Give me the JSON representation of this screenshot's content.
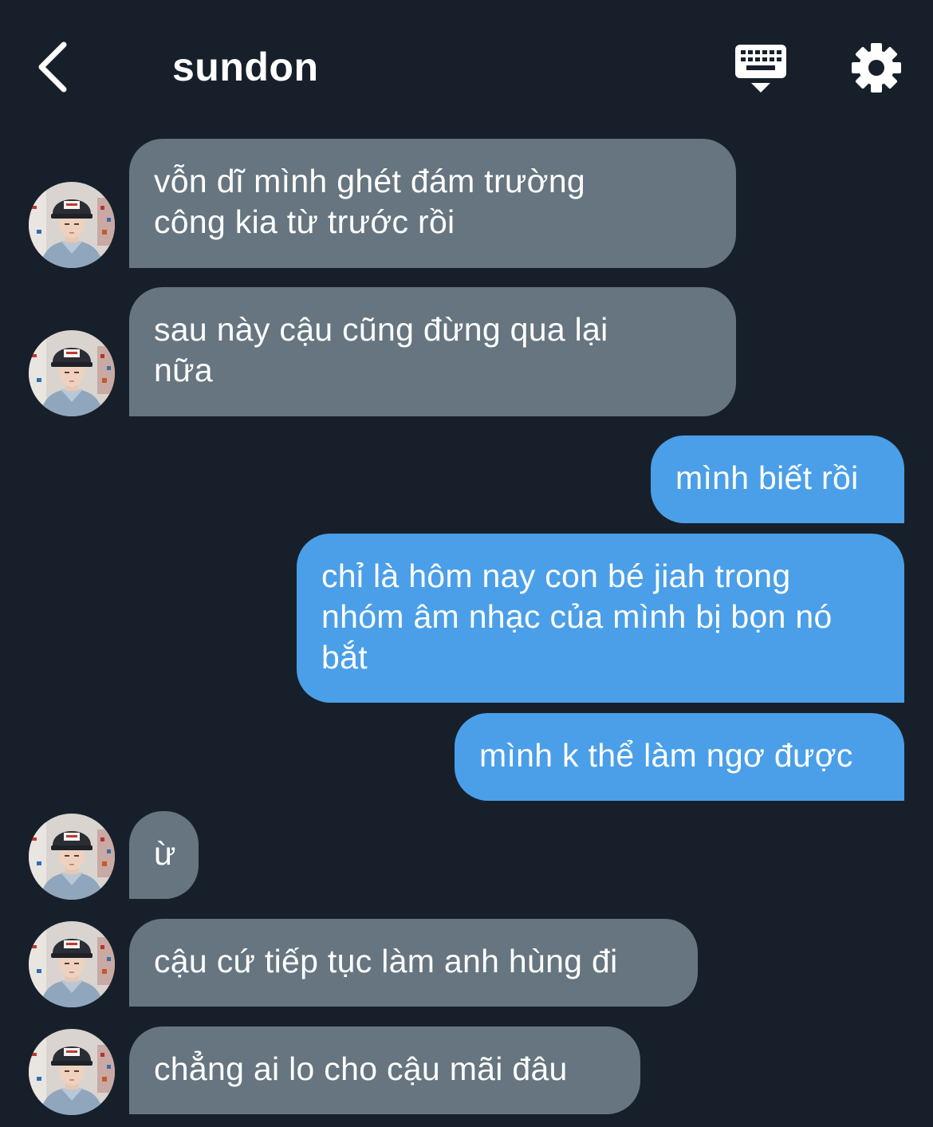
{
  "header": {
    "back_icon": "chevron-left-icon",
    "title": "sundon",
    "keyboard_icon": "keyboard-icon",
    "settings_icon": "gear-icon"
  },
  "colors": {
    "background": "#17202a",
    "incoming_bubble": "#66757f",
    "outgoing_bubble": "#4a9fe8",
    "text": "#ffffff"
  },
  "messages": [
    {
      "side": "incoming",
      "text_lines": [
        "vỗn dĩ mình ghét đám trường",
        "công kia từ trước rồi"
      ]
    },
    {
      "side": "incoming",
      "text_lines": [
        "sau này cậu cũng đừng qua lại",
        "nữa"
      ]
    },
    {
      "side": "outgoing",
      "text_lines": [
        "mình biết rồi"
      ]
    },
    {
      "side": "outgoing",
      "text_lines": [
        "chỉ là hôm nay con bé jiah trong",
        "nhóm âm nhạc của mình bị bọn nó",
        "bắt"
      ]
    },
    {
      "side": "outgoing",
      "text_lines": [
        "mình k thể làm ngơ được"
      ]
    },
    {
      "side": "incoming",
      "text_lines": [
        "ừ"
      ]
    },
    {
      "side": "incoming",
      "text_lines": [
        "cậu cứ tiếp tục làm anh hùng đi"
      ]
    },
    {
      "side": "incoming",
      "text_lines": [
        "chẳng ai lo cho cậu mãi đâu"
      ]
    }
  ]
}
